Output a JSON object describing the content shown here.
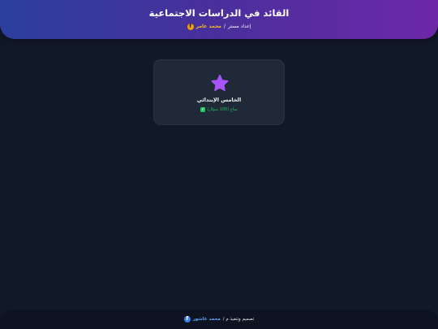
{
  "header": {
    "title": "القائد في الدراسات الاجتماعية",
    "prepared_by": "إعداد مستر",
    "separator": "/",
    "author": "محمد عامر",
    "author_icon": "facebook-icon"
  },
  "grades": [
    {
      "icon": "star-icon",
      "icon_color": "#a855f7",
      "title": "الخامس الإبتدائي",
      "status": "متاح (100 سؤال)",
      "status_icon": "check-icon",
      "status_color": "#22c55e"
    }
  ],
  "footer": {
    "design_text": "تصميم وتنفيذ م /",
    "author": "محمد عاشور",
    "author_icon": "facebook-icon"
  },
  "colors": {
    "background": "#111827",
    "card": "#1f2937",
    "header_gradient_start": "#2b3f9e",
    "header_gradient_end": "#6d28a8",
    "author_accent": "#fbbf24",
    "footer_link": "#60a5fa"
  }
}
